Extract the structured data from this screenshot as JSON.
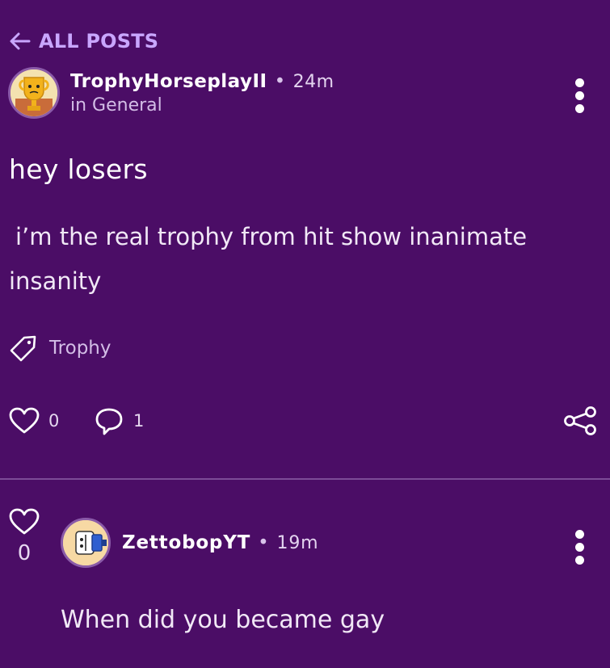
{
  "nav": {
    "back_label": "ALL POSTS"
  },
  "post": {
    "author": "TrophyHorseplayII",
    "time": "24m",
    "category": "in General",
    "title": "hey losers",
    "body": "i’m the real trophy from hit show inanimate insanity",
    "tag": "Trophy",
    "likes": "0",
    "comments": "1"
  },
  "comment": {
    "author": "ZettobopYT",
    "time": "19m",
    "likes": "0",
    "body": "When did you became gay"
  },
  "colors": {
    "background": "#4b0d66",
    "accent": "#c9a6ff",
    "divider": "#7c4b97"
  }
}
